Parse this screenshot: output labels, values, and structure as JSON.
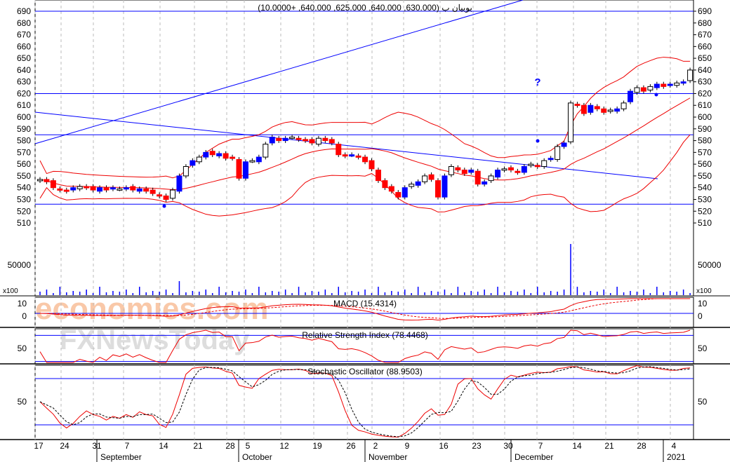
{
  "chart_data": {
    "type": "candlestick",
    "title": "بوبيان ب (630.000, 640.000, 625.000, 640.000, +10.0000)",
    "price_ticks": [
      690,
      680,
      670,
      660,
      650,
      640,
      630,
      620,
      610,
      600,
      590,
      580,
      570,
      560,
      550,
      540,
      530,
      520,
      510
    ],
    "ylim": [
      505,
      693
    ],
    "closes": [
      547,
      545,
      540,
      538,
      537,
      540,
      541,
      540,
      538,
      540,
      538,
      540,
      539,
      540,
      538,
      539,
      537,
      535,
      533,
      530,
      538,
      550,
      558,
      563,
      566,
      570,
      568,
      569,
      565,
      565,
      548,
      562,
      563,
      566,
      577,
      583,
      580,
      582,
      583,
      581,
      580,
      578,
      582,
      580,
      578,
      568,
      567,
      568,
      566,
      562,
      556,
      546,
      540,
      537,
      532,
      540,
      543,
      545,
      550,
      547,
      532,
      550,
      558,
      555,
      552,
      555,
      543,
      545,
      550,
      555,
      556,
      555,
      553,
      558,
      560,
      558,
      563,
      565,
      575,
      578,
      612,
      610,
      603,
      610,
      607,
      604,
      606,
      607,
      612,
      622,
      625,
      622,
      626,
      628,
      626,
      628,
      629,
      630,
      640
    ],
    "horizontal_lines": [
      690,
      620,
      585,
      526
    ],
    "volume_label": "50000",
    "volume_multiplier": "x100",
    "x_day_labels": [
      "17",
      "24",
      "31",
      "7",
      "14",
      "21",
      "28",
      "5",
      "12",
      "19",
      "26",
      "2",
      "9",
      "16",
      "23",
      "30",
      "7",
      "14",
      "21",
      "28",
      "4"
    ],
    "x_month_labels": [
      "September",
      "October",
      "November",
      "December",
      "2021"
    ],
    "annotation": "?",
    "macd": {
      "title": "MACD (15.4314)",
      "ticks": [
        "10",
        "0"
      ]
    },
    "rsi": {
      "title": "Relative Strength Index (78.4468)",
      "ticks": [
        "50"
      ]
    },
    "stoch": {
      "title": "Stochastic Oscillator (88.9503)",
      "ticks": [
        "50"
      ]
    }
  },
  "watermark": {
    "line1": "economies.com",
    "line2": "FXNewsToday"
  }
}
